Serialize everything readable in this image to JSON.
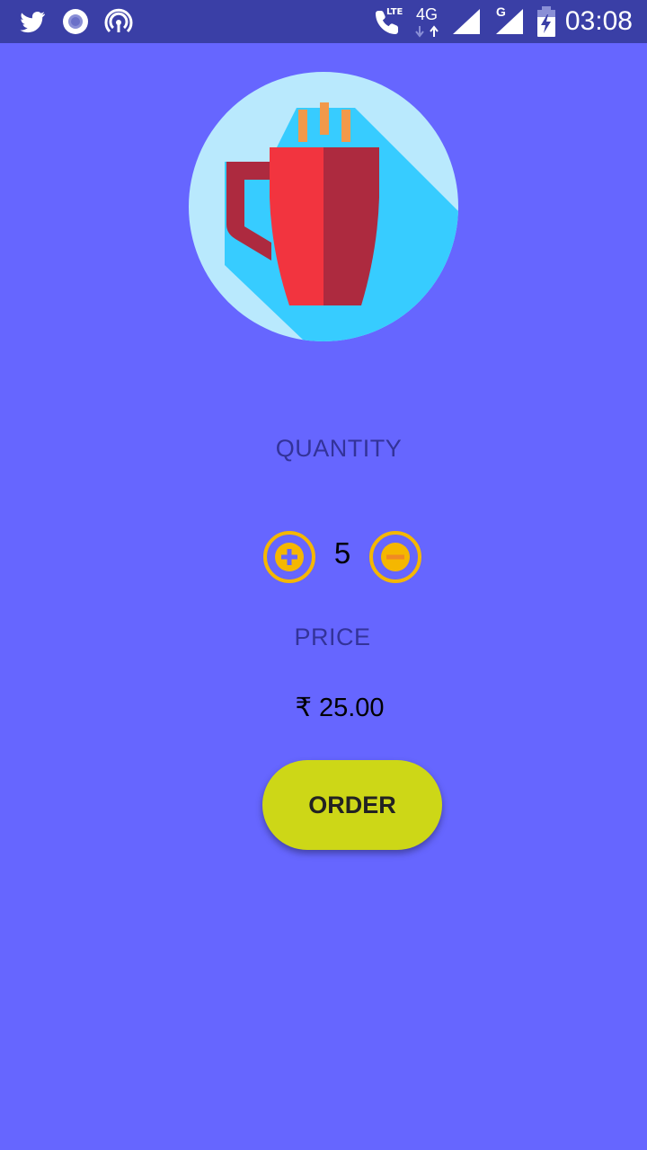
{
  "status_bar": {
    "time": "03:08",
    "network_label": "4G",
    "lte_label": "LTE",
    "secondary_network_label": "G",
    "icons": [
      "twitter-icon",
      "circle-notification-icon",
      "hotspot-icon",
      "phone-lte-icon",
      "signal-icon",
      "battery-charging-icon"
    ]
  },
  "hero": {
    "icon": "coffee-mug-icon"
  },
  "quantity": {
    "label": "QUANTITY",
    "value": "5",
    "increment_icon": "plus-circle-icon",
    "decrement_icon": "minus-circle-icon"
  },
  "price": {
    "label": "PRICE",
    "value": "₹ 25.00"
  },
  "order": {
    "label": "ORDER"
  },
  "colors": {
    "background": "#6666ff",
    "status_bar": "#3a3fa6",
    "label": "#333399",
    "order_button": "#cdd717",
    "stepper_ring": "#f5b700"
  }
}
